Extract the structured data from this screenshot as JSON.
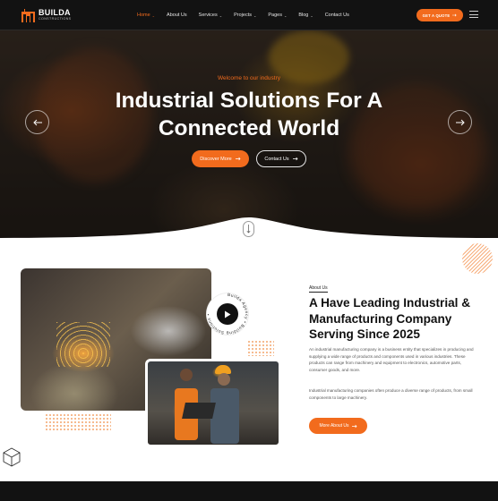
{
  "brand": {
    "name": "BUILDA",
    "tagline": "CONSTRUCTIONS",
    "accent": "#f26b1d"
  },
  "nav": {
    "items": [
      {
        "label": "Home",
        "caret": "⌄",
        "active": true
      },
      {
        "label": "About Us",
        "caret": ""
      },
      {
        "label": "Services",
        "caret": "⌄"
      },
      {
        "label": "Projects",
        "caret": "⌄"
      },
      {
        "label": "Pages",
        "caret": "⌄"
      },
      {
        "label": "Blog",
        "caret": "⌄"
      },
      {
        "label": "Contact Us",
        "caret": ""
      }
    ],
    "quote_label": "GET A QUOTE",
    "menu_icon": "hamburger-icon"
  },
  "hero": {
    "eyebrow": "Welcome to our industry",
    "title_line1": "Industrial Solutions For A",
    "title_line2": "Connected World",
    "discover_label": "Discover More",
    "contact_label": "Contact Us"
  },
  "about": {
    "tag": "About Us",
    "title": "A Have Leading Industrial & Manufacturing Company Serving Since 2025",
    "paragraph1": "An industrial manufacturing company is a business entity that specializes in producing and supplying a wide range of products and components used in various industries. These products can range from machinery and equipment to electronics, automotive parts, consumer goods, and more.",
    "paragraph2": "Industrial manufacturing companies often produce a diverse range of products, from small components to large machinery.",
    "more_label": "More About Us",
    "badge_text": "Builda Agency • Building Solutions •"
  }
}
